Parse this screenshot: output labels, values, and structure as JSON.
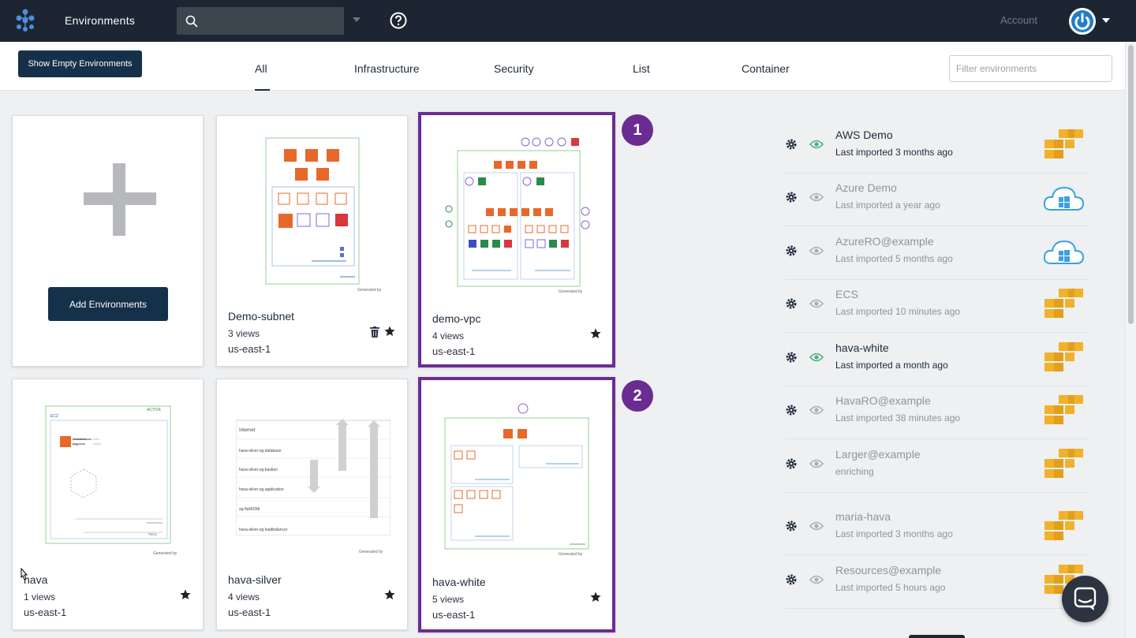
{
  "header": {
    "app_title": "Environments",
    "search_value": "",
    "account_label": "Account"
  },
  "toolbar": {
    "show_empty_label": "Show Empty Environments",
    "filter_placeholder": "Filter environments",
    "tabs": [
      {
        "label": "All",
        "active": true
      },
      {
        "label": "Infrastructure",
        "active": false
      },
      {
        "label": "Security",
        "active": false
      },
      {
        "label": "List",
        "active": false
      },
      {
        "label": "Container",
        "active": false
      }
    ]
  },
  "add_card": {
    "button_label": "Add Environments"
  },
  "cards": [
    {
      "name": "Demo-subnet",
      "views": "3 views",
      "region": "us-east-1",
      "starred": true,
      "deletable": true
    },
    {
      "name": "demo-vpc",
      "views": "4 views",
      "region": "us-east-1",
      "starred": true,
      "highlighted": true,
      "badge": "1"
    },
    {
      "name": "hava",
      "views": "1 views",
      "region": "us-east-1",
      "starred": true
    },
    {
      "name": "hava-silver",
      "views": "4 views",
      "region": "us-east-1",
      "starred": true
    },
    {
      "name": "hava-white",
      "views": "5 views",
      "region": "us-east-1",
      "starred": true,
      "highlighted": true,
      "badge": "2"
    }
  ],
  "thumb_text": {
    "generated_by": "Generated by",
    "active": "ACTIVE",
    "ec2": "EC2",
    "container": "Container",
    "port": "Port",
    "internet": "Internet",
    "db_group": "hava-silver-sg-database",
    "bastion_group": "hava-silver-sg-bastion",
    "app_group": "hava-silver-sg-application",
    "group_4": "sg-8af420fb",
    "lb_group": "hava-silver-sg-loadbalancer",
    "hava_label": "hava"
  },
  "environments": [
    {
      "name": "AWS Demo",
      "status": "Last imported 3 months ago",
      "provider": "aws",
      "visible": true
    },
    {
      "name": "Azure Demo",
      "status": "Last imported a year ago",
      "provider": "azure",
      "visible": false
    },
    {
      "name": "AzureRO@example",
      "status": "Last imported 5 months ago",
      "provider": "azure",
      "visible": false
    },
    {
      "name": "ECS",
      "status": "Last imported 10 minutes ago",
      "provider": "aws",
      "visible": false
    },
    {
      "name": "hava-white",
      "status": "Last imported a month ago",
      "provider": "aws",
      "visible": true
    },
    {
      "name": "HavaRO@example",
      "status": "Last imported 38 minutes ago",
      "provider": "aws",
      "visible": false
    },
    {
      "name": "Larger@example",
      "status": "enriching",
      "provider": "aws",
      "visible": false
    },
    {
      "name": "maria-hava",
      "status": "Last imported 3 months ago",
      "provider": "aws",
      "visible": false
    },
    {
      "name": "Resources@example",
      "status": "Last imported 5 hours ago",
      "provider": "aws",
      "visible": false
    }
  ],
  "colors": {
    "topbar": "#1c2531",
    "highlight": "#6b2c91",
    "primary_button": "#153049",
    "eye_active": "#4caf7d",
    "aws": "#f2b12b",
    "azure": "#3ba0e0"
  }
}
